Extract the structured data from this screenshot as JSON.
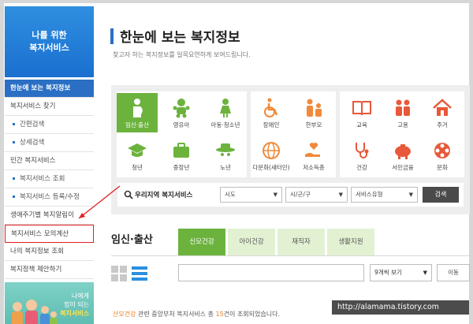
{
  "sidebar": {
    "banner_line1": "나를 위한",
    "banner_line2": "복지서비스",
    "items": [
      {
        "label": "한눈에 보는 복지정보",
        "type": "active"
      },
      {
        "label": "복지서비스 찾기",
        "type": "main"
      },
      {
        "label": "간편검색",
        "type": "sub"
      },
      {
        "label": "상세검색",
        "type": "sub"
      },
      {
        "label": "민간 복지서비스",
        "type": "main"
      },
      {
        "label": "복지서비스 조회",
        "type": "sub"
      },
      {
        "label": "복지서비스 등록/수정",
        "type": "sub"
      },
      {
        "label": "생애주기별 복지알림이",
        "type": "main"
      },
      {
        "label": "복지서비스 모의계산",
        "type": "highlight"
      },
      {
        "label": "나의 복지정보 조회",
        "type": "main"
      },
      {
        "label": "복지정책 제안하기",
        "type": "main"
      }
    ],
    "promo_line1": "나에게",
    "promo_line2": "힘이 되는",
    "promo_line3": "복지서비스"
  },
  "header": {
    "title": "한눈에 보는 복지정보",
    "subtitle": "찾고자 하는 복지정보를 일목요연하게 보여드립니다."
  },
  "categories": {
    "life": [
      {
        "label": "임신·출산",
        "icon": "pregnancy-icon",
        "selected": true
      },
      {
        "label": "영유아",
        "icon": "infant-icon"
      },
      {
        "label": "아동·청소년",
        "icon": "child-icon"
      },
      {
        "label": "청년",
        "icon": "graduation-cap-icon"
      },
      {
        "label": "중장년",
        "icon": "briefcase-icon"
      },
      {
        "label": "노년",
        "icon": "elderly-hat-icon"
      }
    ],
    "target": [
      {
        "label": "장애인",
        "icon": "wheelchair-icon"
      },
      {
        "label": "한부모",
        "icon": "family-icon"
      },
      {
        "label": "다문화(새터민)",
        "icon": "globe-icon"
      },
      {
        "label": "저소득층",
        "icon": "hand-heart-icon"
      }
    ],
    "theme": [
      {
        "label": "교육",
        "icon": "book-icon"
      },
      {
        "label": "고용",
        "icon": "employment-icon"
      },
      {
        "label": "주거",
        "icon": "house-icon"
      },
      {
        "label": "건강",
        "icon": "stethoscope-icon"
      },
      {
        "label": "서민금융",
        "icon": "piggy-bank-icon"
      },
      {
        "label": "문화",
        "icon": "film-reel-icon"
      }
    ]
  },
  "filter": {
    "label": "우리지역 복지서비스",
    "sido": "시도",
    "sigungu": "시/군/구",
    "service_type": "서비스유형",
    "search_button": "검색"
  },
  "section": {
    "title": "임신·출산",
    "tabs": [
      "신모건강",
      "아이건강",
      "재직자",
      "생활지원"
    ],
    "count_option": "9개씩 보기",
    "move_button": "이동"
  },
  "result": {
    "highlight": "산모건강",
    "mid": " 관련 중앙부처 복지서비스 총 ",
    "count": "15",
    "end": "건이 조회되었습니다."
  },
  "watermark": "http://alamama.tistory.com",
  "colors": {
    "accent_blue": "#2a6fc4",
    "accent_green": "#6cb33e",
    "icon_orange": "#f08a3a",
    "highlight_red": "#e02020"
  }
}
